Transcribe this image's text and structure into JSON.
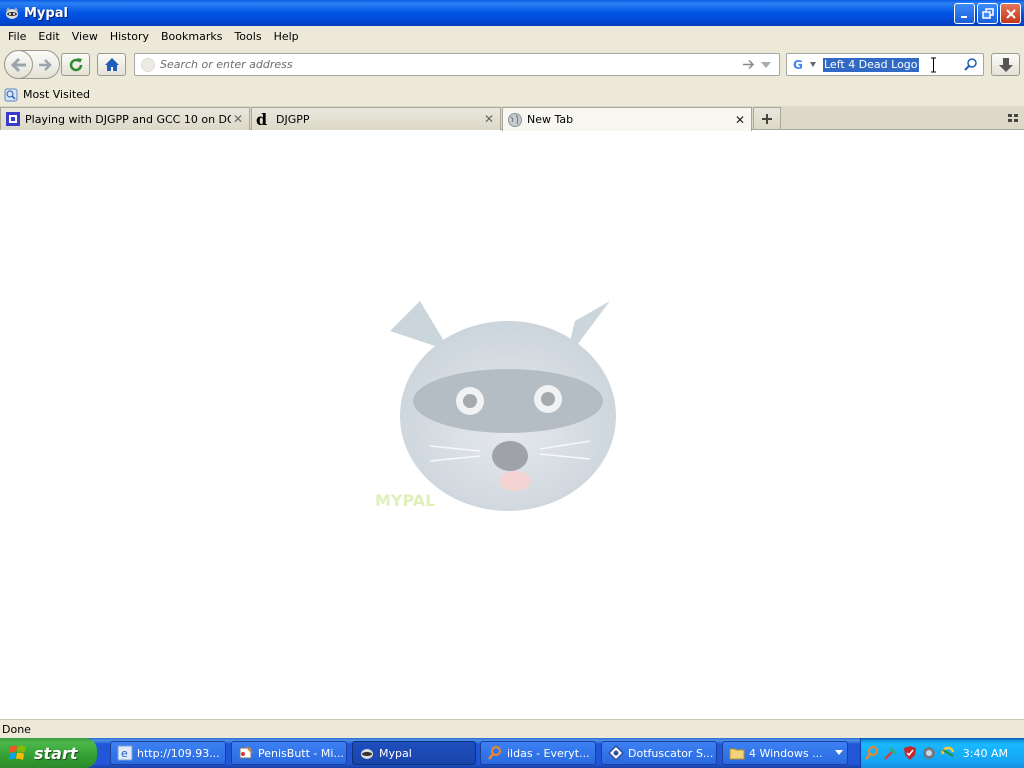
{
  "window": {
    "title": "Mypal"
  },
  "menu": [
    "File",
    "Edit",
    "View",
    "History",
    "Bookmarks",
    "Tools",
    "Help"
  ],
  "navbar": {
    "url_placeholder": "Search or enter address",
    "search_query": "Left 4 Dead Logo"
  },
  "bookmarks": {
    "most_visited": "Most Visited"
  },
  "tabs": [
    {
      "label": "Playing with DJGPP and GCC 10 on DOS |...",
      "icon": "square-favicon"
    },
    {
      "label": "DJGPP",
      "icon": "djgpp-favicon"
    },
    {
      "label": "New Tab",
      "icon": "globe-icon"
    }
  ],
  "content": {
    "watermark": "MYPAL"
  },
  "status": {
    "text": "Done"
  },
  "taskbar": {
    "start_label": "start",
    "tasks": [
      {
        "label": "http://109.93...",
        "icon": "ie-icon"
      },
      {
        "label": "PenisButt - Mi...",
        "icon": "paint-icon"
      },
      {
        "label": "Mypal",
        "icon": "mypal-icon"
      },
      {
        "label": "ildas - Everyt...",
        "icon": "everything-icon"
      },
      {
        "label": "Dotfuscator S...",
        "icon": "dotfuscator-icon"
      },
      {
        "label": "4 Windows ...",
        "icon": "folder-icon"
      }
    ],
    "clock": "3:40 AM"
  }
}
